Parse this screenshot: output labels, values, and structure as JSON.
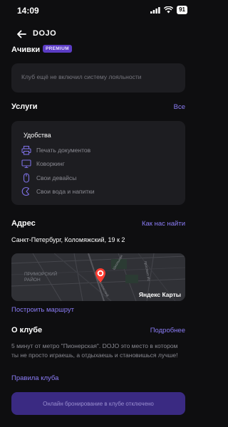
{
  "status_bar": {
    "time": "14:09",
    "battery": "91"
  },
  "header": {
    "title": "DOJO"
  },
  "loyalty": {
    "title": "Ачивки",
    "badge": "PREMIUM",
    "message": "Клуб ещё не включил систему лояльности"
  },
  "services": {
    "title": "Услуги",
    "all_link": "Все",
    "card_title": "Удобства",
    "items": [
      {
        "label": "Печать документов",
        "icon": "printer-icon"
      },
      {
        "label": "Коворкинг",
        "icon": "monitor-icon"
      },
      {
        "label": "Свои девайсы",
        "icon": "mouse-icon"
      },
      {
        "label": "Свои вода и напитки",
        "icon": "cup-icon"
      }
    ]
  },
  "address": {
    "title": "Адрес",
    "find_link": "Как нас найти",
    "value": "Санкт-Петербург, Коломяжский, 19 к 2",
    "map_district": "ПРИМОРСКИЙ\nРАЙОН",
    "map_brand": "Яндекс Карты",
    "map_streets": [
      "Коломяжский",
      "Школьная",
      "проспект Ис"
    ],
    "route_link": "Построить маршрут"
  },
  "about": {
    "title": "О клубе",
    "more_link": "Подробнее",
    "text": "5 минут от метро \"Пионерская\". DOJO это место в котором ты не просто играешь, а отдыхаешь и становишься лучше!",
    "rules_link": "Правила клуба"
  },
  "booking": {
    "label": "Онлайн бронирование в клубе отключено"
  },
  "colors": {
    "accent": "#8b7cf6",
    "badge": "#5b3cc4",
    "card": "#1d1d21",
    "background": "#0e0e10"
  }
}
